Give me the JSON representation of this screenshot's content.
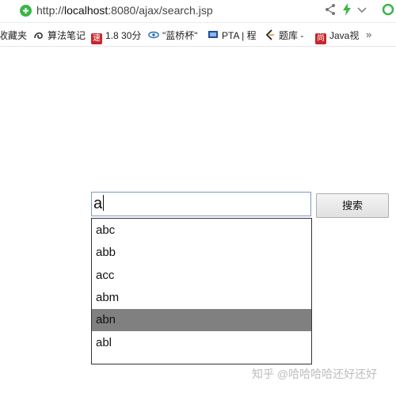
{
  "browser": {
    "url_prefix": "http://",
    "url_host": "localhost",
    "url_rest": ":8080/ajax/search.jsp"
  },
  "bookmarks": {
    "items": [
      {
        "label": "收藏夹"
      },
      {
        "label": "算法笔记"
      },
      {
        "label": "1.8  30分"
      },
      {
        "label": "\"蓝桥杯\""
      },
      {
        "label": "PTA | 程"
      },
      {
        "label": "题库 -"
      },
      {
        "label": "Java视"
      }
    ],
    "more": "»",
    "icon_letters": {
      "speed": "速",
      "shang": "尚"
    }
  },
  "search": {
    "query": "a",
    "button_label": "搜索",
    "suggestions": [
      {
        "text": "abc"
      },
      {
        "text": "abb"
      },
      {
        "text": "acc"
      },
      {
        "text": "abm"
      },
      {
        "text": "abn"
      },
      {
        "text": "abl"
      }
    ],
    "highlighted_suggestion": "abn"
  },
  "watermark": "知乎 @哈哈哈哈还好还好",
  "colors": {
    "highlight": "#808080",
    "input_border": "#7a9cc8",
    "secure_green": "#3cb54a"
  }
}
